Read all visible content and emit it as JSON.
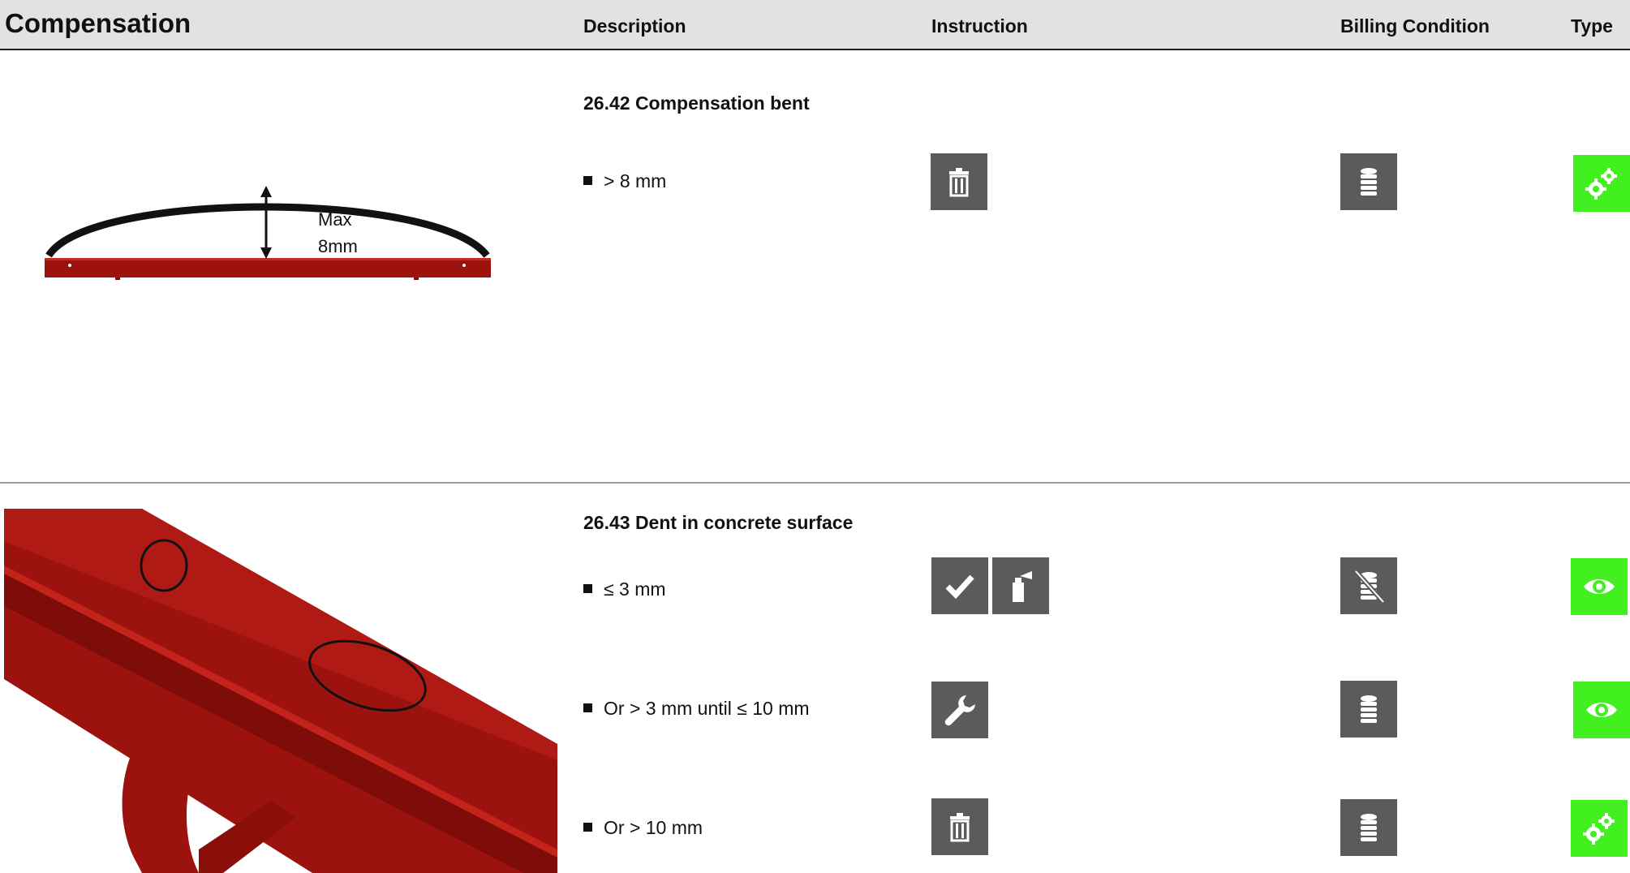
{
  "header": {
    "title": "Compensation",
    "columns": [
      "Description",
      "Instruction",
      "Billing Condition",
      "Type"
    ]
  },
  "sections": [
    {
      "title": "26.42 Compensation bent",
      "figure": {
        "label_line1": "Max",
        "label_line2": "8mm"
      },
      "rows": [
        {
          "description": "> 8 mm",
          "instruction_icons": [
            "trash-icon"
          ],
          "billing_icon": "coin-stack-icon",
          "type_icon": "gears-icon"
        }
      ]
    },
    {
      "title": "26.43 Dent in concrete surface",
      "rows": [
        {
          "description": "≤ 3 mm",
          "instruction_icons": [
            "check-icon",
            "spray-can-icon"
          ],
          "billing_icon": "coin-stack-crossed-icon",
          "type_icon": "eye-icon"
        },
        {
          "description": "Or > 3 mm until ≤ 10 mm",
          "instruction_icons": [
            "wrench-icon"
          ],
          "billing_icon": "coin-stack-icon",
          "type_icon": "eye-icon"
        },
        {
          "description": "Or > 10 mm",
          "instruction_icons": [
            "trash-icon"
          ],
          "billing_icon": "coin-stack-icon",
          "type_icon": "gears-icon"
        }
      ]
    }
  ],
  "colors": {
    "icon_gray": "#5b5b5b",
    "type_green": "#43f01f",
    "part_red": "#9b120e"
  }
}
